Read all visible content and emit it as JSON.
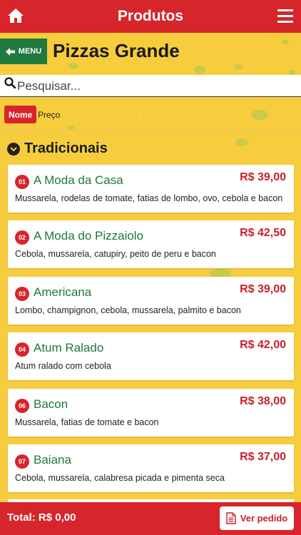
{
  "header": {
    "title": "Produtos",
    "home_icon": "home-icon",
    "menu_icon": "hamburger-icon"
  },
  "section": {
    "menu_label": "MENU",
    "title": "Pizzas Grande"
  },
  "search": {
    "placeholder": "Pesquisar...",
    "value": ""
  },
  "sort": {
    "active": "Nome",
    "other": "Preço"
  },
  "category": {
    "label": "Tradicionais"
  },
  "products": [
    {
      "num": "01",
      "name": "A Moda da Casa",
      "price": "R$ 39,00",
      "desc": "Mussarela, rodelas de tomate, fatias de lombo, ovo, cebola e bacon"
    },
    {
      "num": "02",
      "name": "A Moda do Pizzaiolo",
      "price": "R$ 42,50",
      "desc": "Cebola, mussarela, catupiry, peito de peru e bacon"
    },
    {
      "num": "03",
      "name": "Americana",
      "price": "R$ 39,00",
      "desc": "Lombo, champignon, cebola, mussarela, palmito e bacon"
    },
    {
      "num": "04",
      "name": "Atum Ralado",
      "price": "R$ 42,00",
      "desc": "Atum ralado com cebola"
    },
    {
      "num": "06",
      "name": "Bacon",
      "price": "R$ 38,00",
      "desc": "Mussarela, fatias de tomate e bacon"
    },
    {
      "num": "07",
      "name": "Baiana",
      "price": "R$ 37,00",
      "desc": "Cebola, mussarela, calabresa picada e pimenta seca"
    }
  ],
  "footer": {
    "total": "Total: R$ 0,00",
    "order_label": "Ver pedido"
  },
  "colors": {
    "primary": "#d6252b",
    "green": "#1f7a3d",
    "background": "#f7cd3e"
  }
}
